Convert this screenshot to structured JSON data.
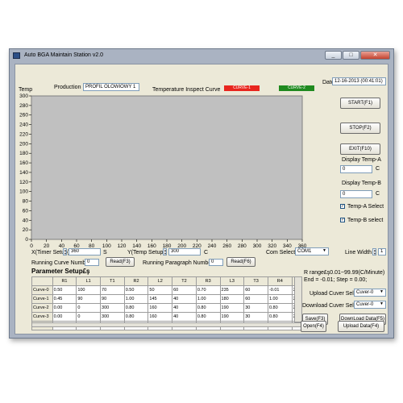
{
  "window": {
    "title": "Auto BGA Maintain Station v2.0",
    "controls": [
      "_",
      "□",
      "✕"
    ]
  },
  "chart_header": {
    "temp_label": "Temp",
    "production_label": "Production",
    "production_value": "PROFIL OLOWIOWY 1",
    "curve_title": "Temperature Inspect Curve",
    "curve1_label": "CURVE-1",
    "curve2_label": "CURVE-2",
    "curve1_color": "#e8261e",
    "curve2_color": "#1f8a1f"
  },
  "chart_data": {
    "type": "line",
    "title": "Temperature Inspect Curve",
    "xlabel": "Time",
    "ylabel": "Temp",
    "xlim": [
      0,
      360
    ],
    "ylim": [
      0,
      300
    ],
    "x_ticks": [
      "0",
      "20",
      "40",
      "60",
      "80",
      "100",
      "120",
      "140",
      "160",
      "180",
      "200",
      "220",
      "240",
      "260",
      "280",
      "300",
      "320",
      "340",
      "360"
    ],
    "y_ticks": [
      "0",
      "20",
      "40",
      "60",
      "80",
      "100",
      "120",
      "140",
      "160",
      "180",
      "200",
      "220",
      "240",
      "260",
      "280",
      "300"
    ],
    "grid": false,
    "series": [],
    "plot_background": "#c0c0c0"
  },
  "date": {
    "label": "Date",
    "value": "12-16-2013 (00:41:01)"
  },
  "buttons": {
    "start": "START(F1)",
    "stop": "STOP(F2)",
    "exit": "EXIT(F10)",
    "read_f3": "Read(F3)",
    "read_f6": "Read(F6)",
    "save": "Save(F3)",
    "open": "Open(F4)",
    "download": "DownLoad Data(F5)",
    "upload": "Upload Data(F4)"
  },
  "display": {
    "temp_a_label": "Display Temp-A",
    "temp_a_value": "0",
    "temp_a_unit": "C",
    "temp_b_label": "Display Temp-B",
    "temp_b_value": "0",
    "temp_b_unit": "C",
    "temp_a_select": "Temp-A  Select",
    "temp_b_select": "Temp-B select",
    "check_mark": "✓"
  },
  "setup": {
    "x_label": "X(Timer Setup)",
    "x_value": "360",
    "x_unit": "S",
    "y_label": "Y(Temp Setup)",
    "y_value": "300",
    "y_unit": "C",
    "com_label": "Com  Select",
    "com_value": "COM1",
    "line_width_label": "Line  Width",
    "line_width_value": "1",
    "running_curve_label": "Running Curve Number",
    "running_curve_value": "0",
    "running_para_label": "Running Paragraph Number",
    "running_para_value": "0"
  },
  "params": {
    "title": "Parameter Setup£ş",
    "range_text": "R range£ş0.01~99.99(C/Minute)",
    "end_step_text": "End = -0.01;      Step = 0.00;",
    "upload_label": "Upload Cuver Select",
    "upload_value": "Cuver-0",
    "download_label": "Download Cuver Select",
    "download_value": "Cuver-0",
    "columns": [
      "",
      "R1",
      "L1",
      "T1",
      "R2",
      "L2",
      "T2",
      "R3",
      "L3",
      "T3",
      "R4",
      ""
    ],
    "rows": [
      [
        "Curve-0",
        "0.50",
        "100",
        "70",
        "0.50",
        "50",
        "60",
        "0.70",
        "235",
        "60",
        "-0.01",
        "25"
      ],
      [
        "Curve-1",
        "0.45",
        "90",
        "90",
        "1.00",
        "145",
        "40",
        "1.00",
        "180",
        "60",
        "1.00",
        "240"
      ],
      [
        "Curve-2",
        "0.00",
        "0",
        "300",
        "0.80",
        "160",
        "40",
        "0.80",
        "190",
        "30",
        "0.80",
        "200"
      ],
      [
        "Curve-3",
        "0.00",
        "0",
        "300",
        "0.80",
        "160",
        "40",
        "0.80",
        "190",
        "30",
        "0.80",
        "200"
      ],
      [
        "Curve-4",
        "0.70",
        "210",
        "90",
        "-0.01",
        "195",
        "40",
        "3.00",
        "215",
        "40",
        "3.00",
        "225"
      ]
    ]
  }
}
